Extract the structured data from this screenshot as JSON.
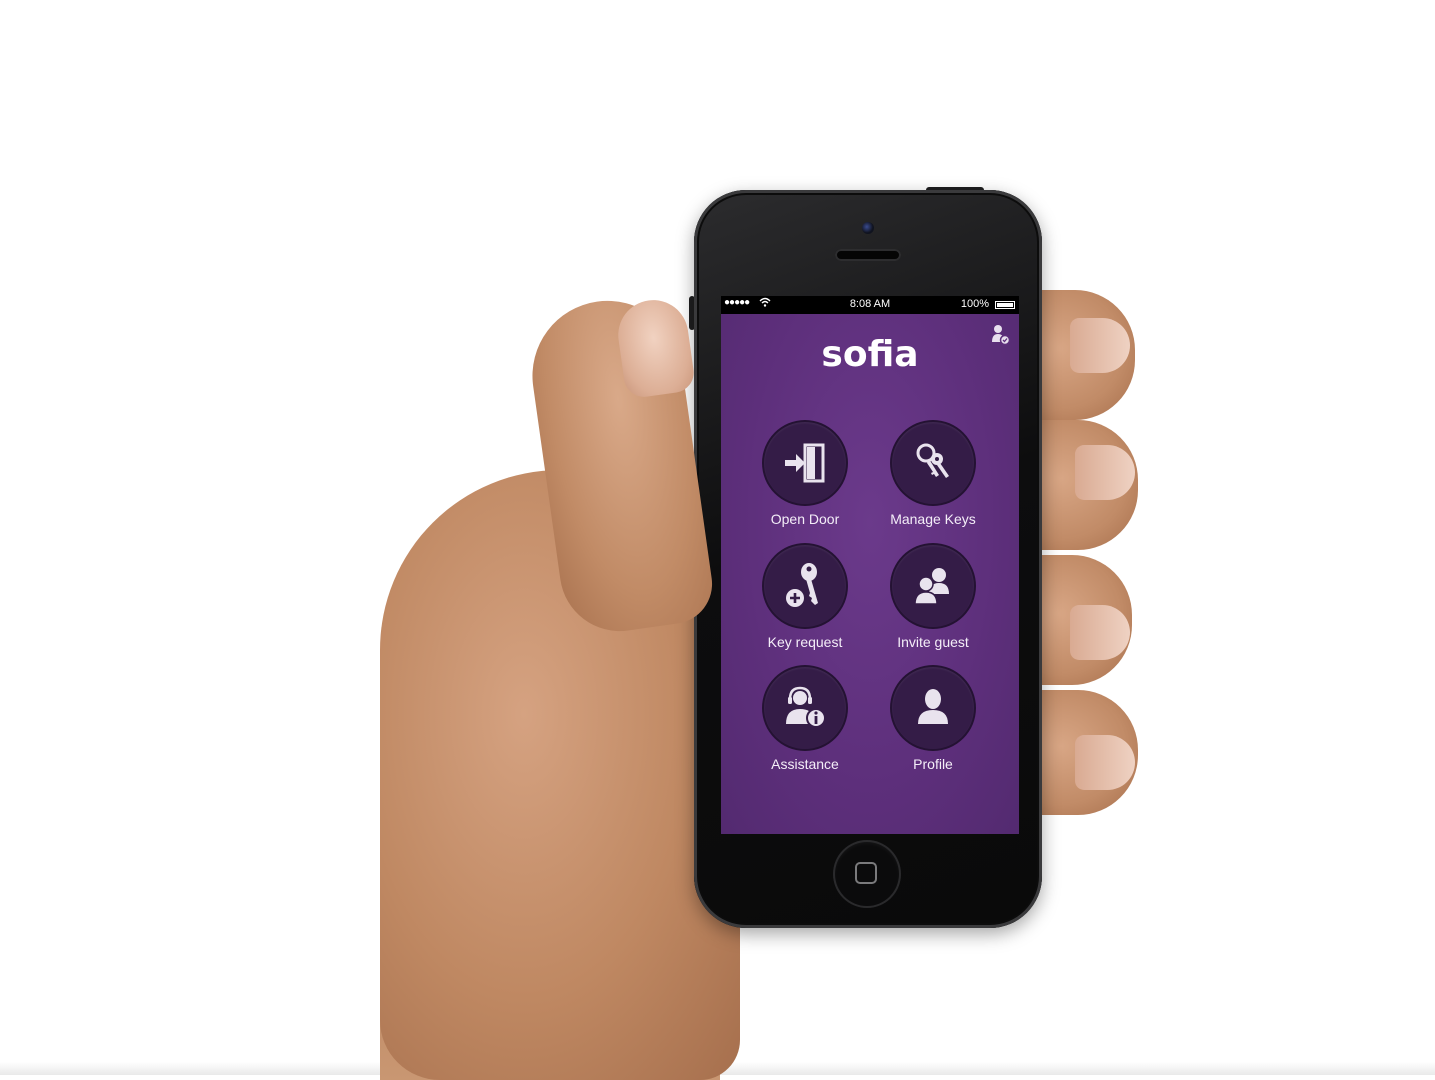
{
  "statusbar": {
    "signal": "●●●●●",
    "time": "8:08 AM",
    "battery": "100%"
  },
  "app": {
    "title": "sofia",
    "icons": [
      "user-shield-icon"
    ]
  },
  "menu": [
    {
      "label": "Open Door",
      "icon": "door-enter-icon"
    },
    {
      "label": "Manage Keys",
      "icon": "keys-icon"
    },
    {
      "label": "Key request",
      "icon": "key-add-icon"
    },
    {
      "label": "Invite guest",
      "icon": "guests-icon"
    },
    {
      "label": "Assistance",
      "icon": "support-agent-icon"
    },
    {
      "label": "Profile",
      "icon": "profile-icon"
    }
  ],
  "colors": {
    "screen_bg": "#5e2f7c",
    "button_bg": "#341c47",
    "text": "#f4eef8"
  }
}
